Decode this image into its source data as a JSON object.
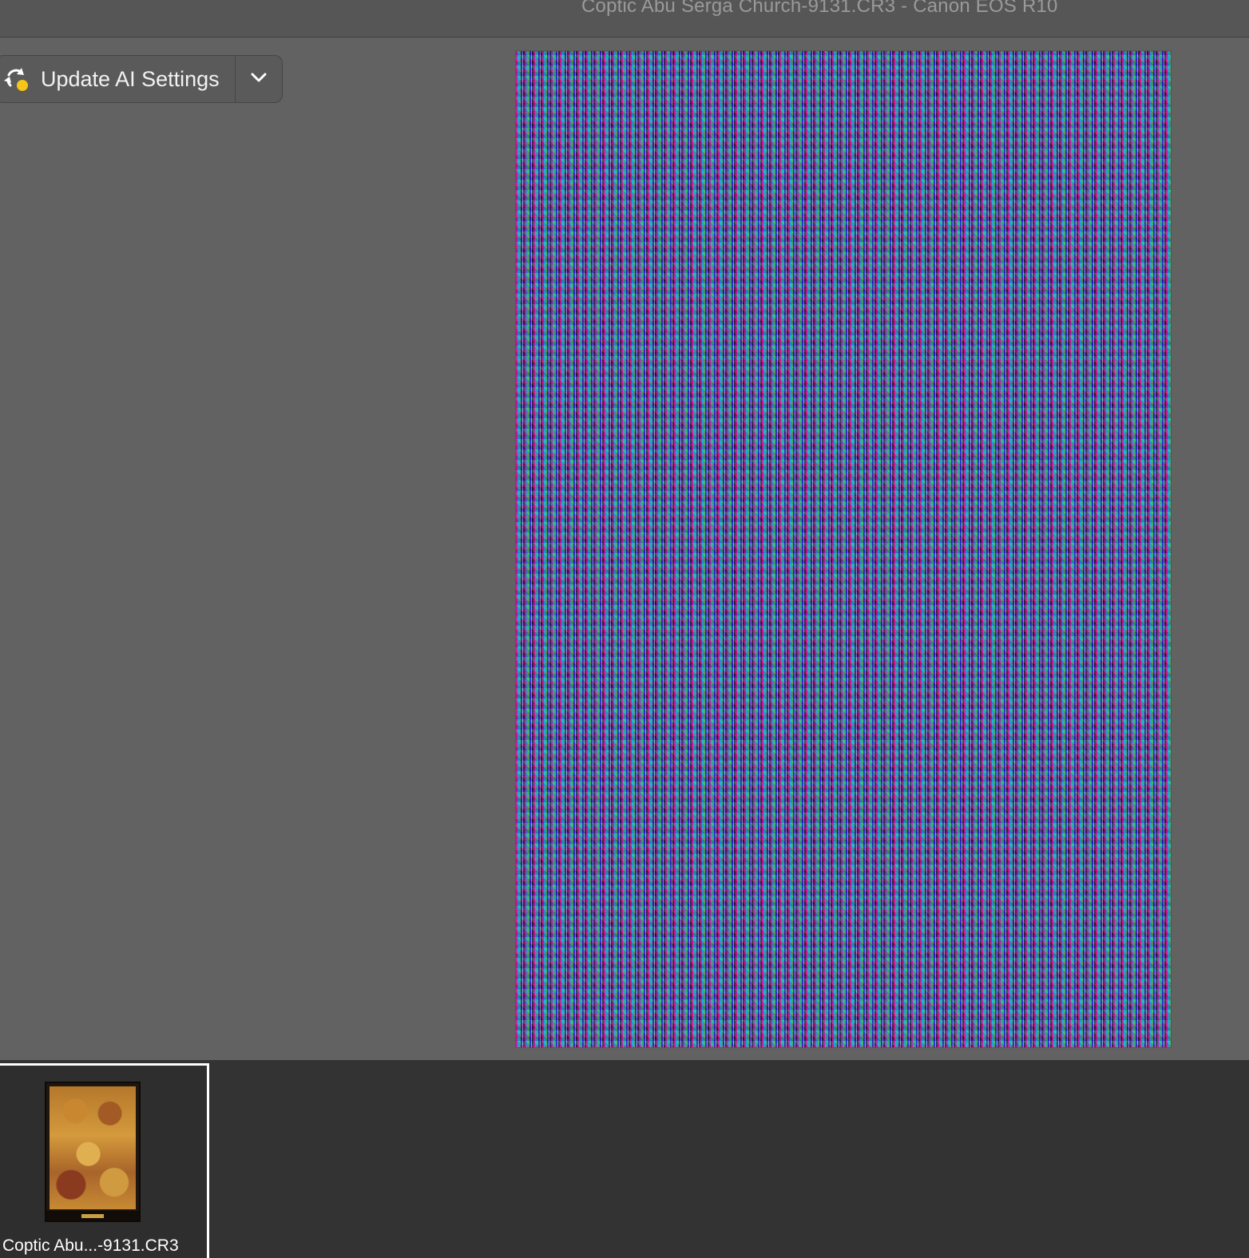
{
  "window": {
    "title": "Coptic Abu Serga Church-9131.CR3  -  Canon EOS R10"
  },
  "toolbar": {
    "update_ai_label": "Update AI Settings",
    "update_ai_icon": "sync-warning-icon",
    "dropdown_icon": "chevron-down-icon",
    "warning_color": "#f5c518"
  },
  "filmstrip": {
    "items": [
      {
        "name": "Coptic Abu...-9131.CR3",
        "selected": true
      }
    ]
  }
}
